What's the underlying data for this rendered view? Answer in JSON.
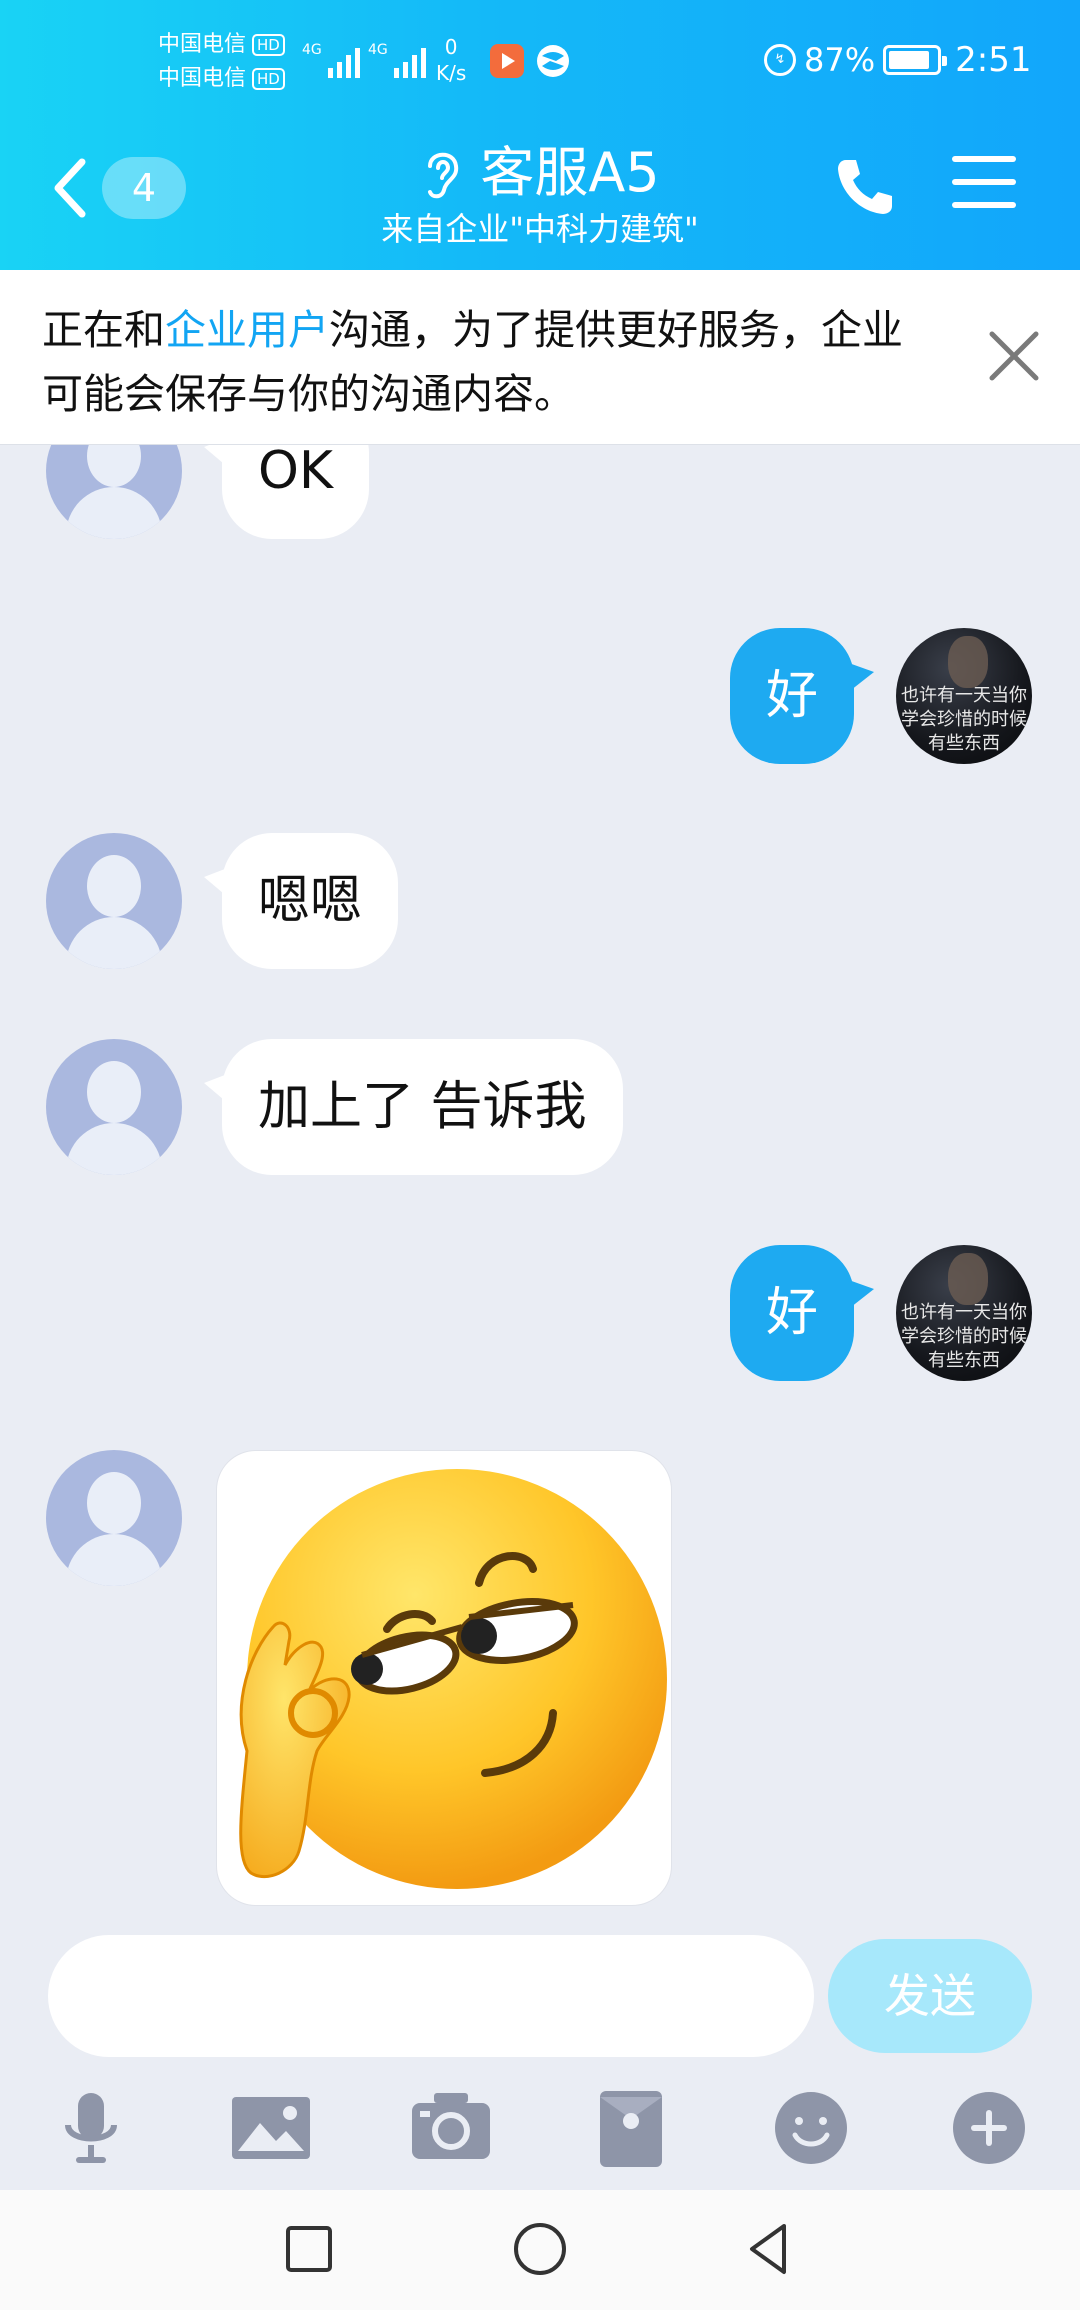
{
  "status_bar": {
    "carrier_1": "中国电信",
    "carrier_2": "中国电信",
    "hd_label": "HD",
    "signal_tag_1": "4G",
    "signal_tag_2": "4G",
    "net_speed_value": "0",
    "net_speed_unit": "K/s",
    "battery_percent": "87%",
    "battery_level": 0.87,
    "time": "2:51"
  },
  "nav": {
    "unread_count": "4",
    "title": "客服A5",
    "subtitle": "来自企业\"中科力建筑\""
  },
  "notice": {
    "text_before": "正在和",
    "highlight": "企业用户",
    "text_after": "沟通，为了提供更好服务，企业可能会保存与你的沟通内容。"
  },
  "messages": [
    {
      "side": "in",
      "text": "OK"
    },
    {
      "side": "out",
      "text": "好"
    },
    {
      "side": "in",
      "text": "嗯嗯"
    },
    {
      "side": "in",
      "text": "加上了 告诉我"
    },
    {
      "side": "out",
      "text": "好"
    },
    {
      "side": "in",
      "type": "sticker",
      "icon": "ok-hand-smirk-emoji"
    }
  ],
  "my_avatar": {
    "line_1": "也许有一天当你",
    "line_2": "学会珍惜的时候",
    "line_3": "有些东西"
  },
  "composer": {
    "input_value": "",
    "send_label": "发送"
  },
  "toolbar_icons": [
    "microphone-icon",
    "image-icon",
    "camera-icon",
    "red-packet-icon",
    "emoji-icon",
    "plus-icon"
  ],
  "colors": {
    "header_start": "#19d3f5",
    "header_end": "#12a6fb",
    "outgoing_bubble": "#1eaaf1",
    "highlight_text": "#12a5f3",
    "send_disabled": "#a7e8fb",
    "chat_background": "#eaedf4"
  }
}
